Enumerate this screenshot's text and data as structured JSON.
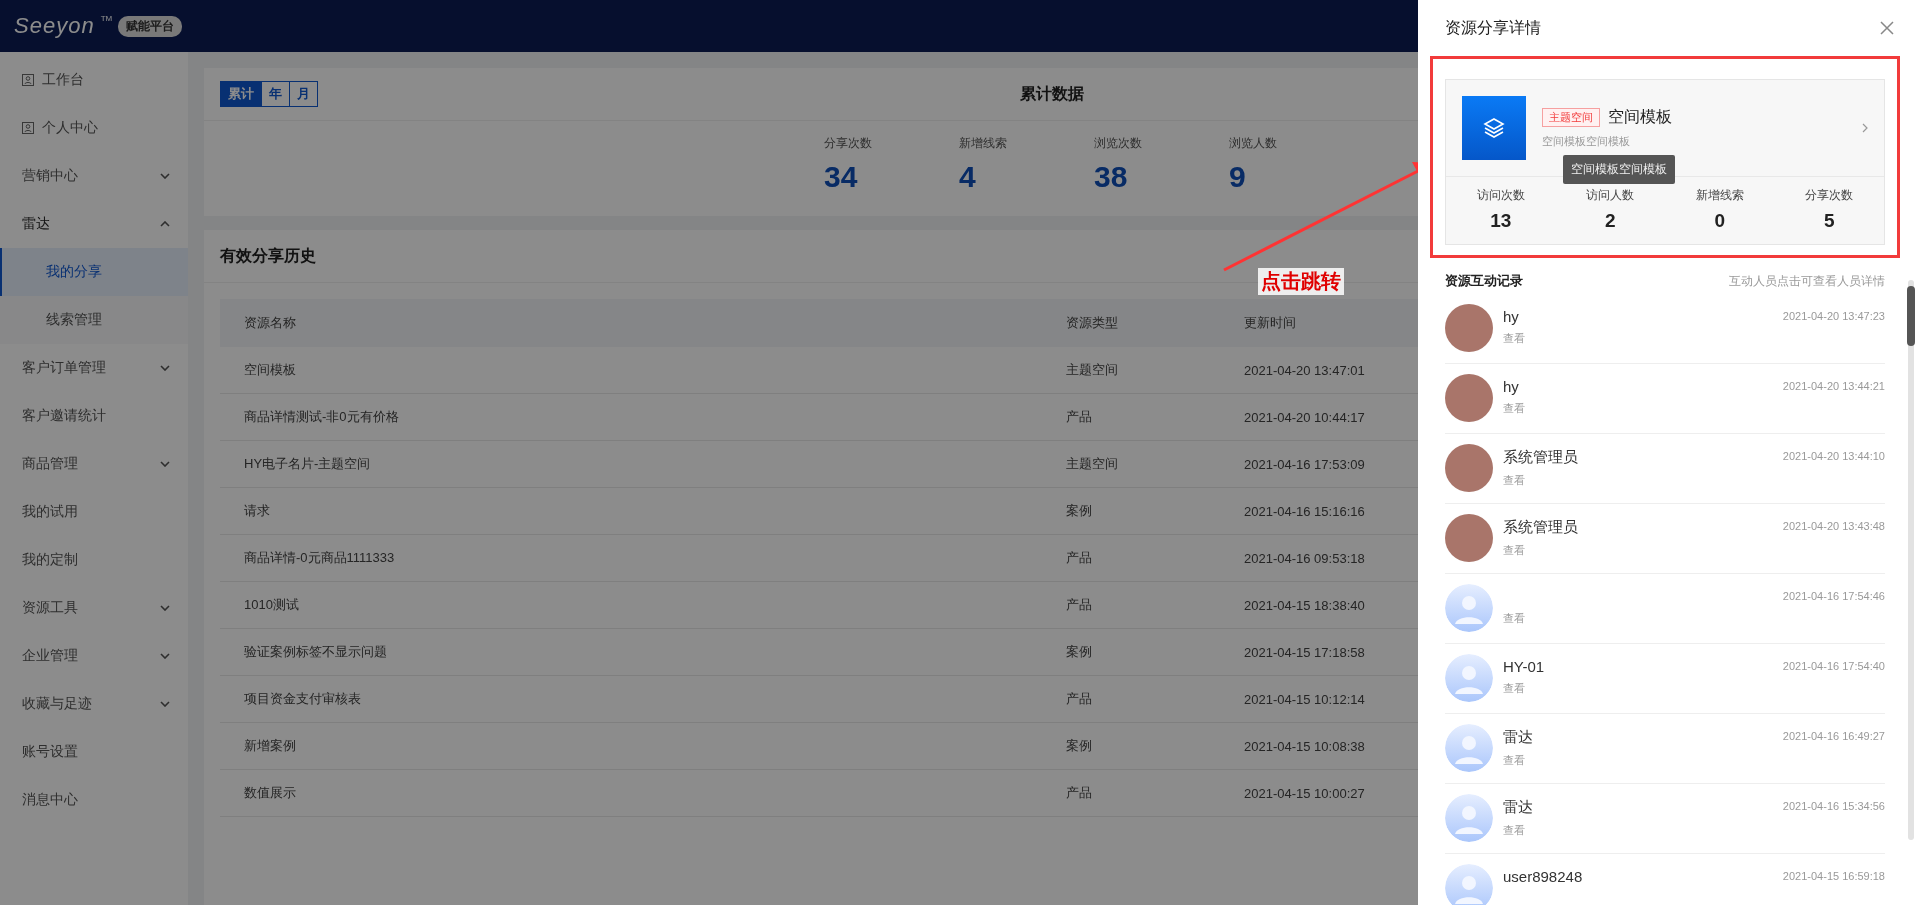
{
  "header": {
    "logo": "Seeyon",
    "trademark": "TM",
    "badge": "赋能平台"
  },
  "sidebar": {
    "items": [
      {
        "label": "工作台",
        "kind": "page",
        "selected": false
      },
      {
        "label": "个人中心",
        "kind": "page",
        "selected": false
      },
      {
        "label": "营销中心",
        "kind": "group",
        "expanded": false,
        "selected": false
      },
      {
        "label": "雷达",
        "kind": "group",
        "expanded": true,
        "selected": false,
        "children": [
          {
            "label": "我的分享",
            "selected": true
          },
          {
            "label": "线索管理",
            "selected": false
          }
        ]
      },
      {
        "label": "客户订单管理",
        "kind": "group",
        "expanded": false,
        "selected": false
      },
      {
        "label": "客户邀请统计",
        "kind": "link",
        "selected": false
      },
      {
        "label": "商品管理",
        "kind": "group",
        "expanded": false,
        "selected": false
      },
      {
        "label": "我的试用",
        "kind": "link",
        "selected": false
      },
      {
        "label": "我的定制",
        "kind": "link",
        "selected": false
      },
      {
        "label": "资源工具",
        "kind": "group",
        "expanded": false,
        "selected": false
      },
      {
        "label": "企业管理",
        "kind": "group",
        "expanded": false,
        "selected": false
      },
      {
        "label": "收藏与足迹",
        "kind": "group",
        "expanded": false,
        "selected": false
      },
      {
        "label": "账号设置",
        "kind": "link",
        "selected": false
      },
      {
        "label": "消息中心",
        "kind": "link",
        "selected": false
      }
    ]
  },
  "summary": {
    "title": "累计数据",
    "tabs": [
      {
        "label": "累计",
        "selected": true
      },
      {
        "label": "年",
        "selected": false
      },
      {
        "label": "月",
        "selected": false
      }
    ],
    "stats": [
      {
        "label": "分享次数",
        "value": "34"
      },
      {
        "label": "新增线索",
        "value": "4"
      },
      {
        "label": "浏览次数",
        "value": "38"
      },
      {
        "label": "浏览人数",
        "value": "9"
      }
    ]
  },
  "history": {
    "title": "有效分享历史",
    "table": {
      "columns": [
        "资源名称",
        "资源类型",
        "更新时间"
      ],
      "rows": [
        [
          "空间模板",
          "主题空间",
          "2021-04-20 13:47:01"
        ],
        [
          "商品详情测试-非0元有价格",
          "产品",
          "2021-04-20 10:44:17"
        ],
        [
          "HY电子名片-主题空间",
          "主题空间",
          "2021-04-16 17:53:09"
        ],
        [
          "请求",
          "案例",
          "2021-04-16 15:16:16"
        ],
        [
          "商品详情-0元商品1111333",
          "产品",
          "2021-04-16 09:53:18"
        ],
        [
          "1010测试",
          "产品",
          "2021-04-15 18:38:40"
        ],
        [
          "验证案例标签不显示问题",
          "案例",
          "2021-04-15 17:18:58"
        ],
        [
          "项目资金支付审核表",
          "产品",
          "2021-04-15 10:12:14"
        ],
        [
          "新增案例",
          "案例",
          "2021-04-15 10:08:38"
        ],
        [
          "数值展示",
          "产品",
          "2021-04-15 10:00:27"
        ]
      ]
    }
  },
  "annotation": {
    "text": "点击跳转"
  },
  "drawer": {
    "title": "资源分享详情",
    "resource": {
      "tag": "主题空间",
      "name": "空间模板",
      "description": "空间模板空间模板",
      "tooltip": "空间模板空间模板",
      "stats": [
        {
          "label": "访问次数",
          "value": "13"
        },
        {
          "label": "访问人数",
          "value": "2"
        },
        {
          "label": "新增线索",
          "value": "0"
        },
        {
          "label": "分享次数",
          "value": "5"
        }
      ]
    },
    "records_title": "资源互动记录",
    "records_hint": "互动人员点击可查看人员详情",
    "records": [
      {
        "kind": "photo",
        "name": "hy",
        "action": "查看",
        "time": "2021-04-20 13:47:23"
      },
      {
        "kind": "photo",
        "name": "hy",
        "action": "查看",
        "time": "2021-04-20 13:44:21"
      },
      {
        "kind": "photo",
        "name": "系统管理员",
        "action": "查看",
        "time": "2021-04-20 13:44:10"
      },
      {
        "kind": "photo",
        "name": "系统管理员",
        "action": "查看",
        "time": "2021-04-20 13:43:48"
      },
      {
        "kind": "default",
        "action": "查看",
        "time": "2021-04-16 17:54:46"
      },
      {
        "kind": "default",
        "name": "HY-01",
        "action": "查看",
        "time": "2021-04-16 17:54:40"
      },
      {
        "kind": "default",
        "name": "雷达",
        "action": "查看",
        "time": "2021-04-16 16:49:27"
      },
      {
        "kind": "default",
        "name": "雷达",
        "action": "查看",
        "time": "2021-04-16 15:34:56"
      },
      {
        "kind": "default",
        "name": "user898248",
        "time": "2021-04-15 16:59:18"
      }
    ]
  }
}
